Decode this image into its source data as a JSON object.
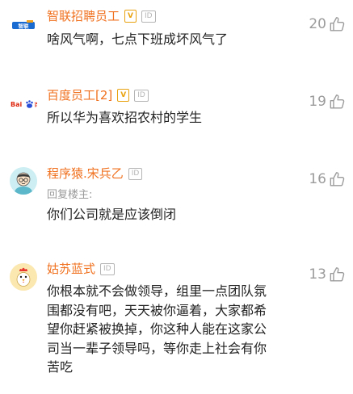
{
  "colors": {
    "name": "#f0711f",
    "badge_v": "#e9a20f",
    "badge_id": "#b5b5b5",
    "text": "#222222",
    "muted": "#9b9b9b"
  },
  "comments": [
    {
      "avatar": {
        "icon": "zhilian-zhaopin-logo",
        "text": "智联招聘"
      },
      "name": "智联招聘员工",
      "verified_badge": "V",
      "id_badge": "ID",
      "text": "啥风气啊，七点下班成坏风气了",
      "likes": "20"
    },
    {
      "avatar": {
        "icon": "baidu-logo",
        "text": "Bai百度"
      },
      "name": "百度员工[2]",
      "verified_badge": "V",
      "id_badge": "ID",
      "text": "所以华为喜欢招农村的学生",
      "likes": "19"
    },
    {
      "avatar": {
        "icon": "cartoon-programmer-avatar"
      },
      "name": "程序猿.宋兵乙",
      "id_badge": "ID",
      "reply_label": "回复楼主:",
      "text": "你们公司就是应该倒闭",
      "likes": "16"
    },
    {
      "avatar": {
        "icon": "cartoon-rooster-avatar"
      },
      "name": "姑苏蓝式",
      "id_badge": "ID",
      "text_lines": [
        "你根本就不会做领导，组里一点团队氛",
        "围都没有吧，天天被你逼着，大家都希",
        "望你赶紧被换掉，你这种人能在这家公",
        "司当一辈子领导吗，等你走上社会有你",
        "苦吃"
      ],
      "likes": "13"
    }
  ]
}
